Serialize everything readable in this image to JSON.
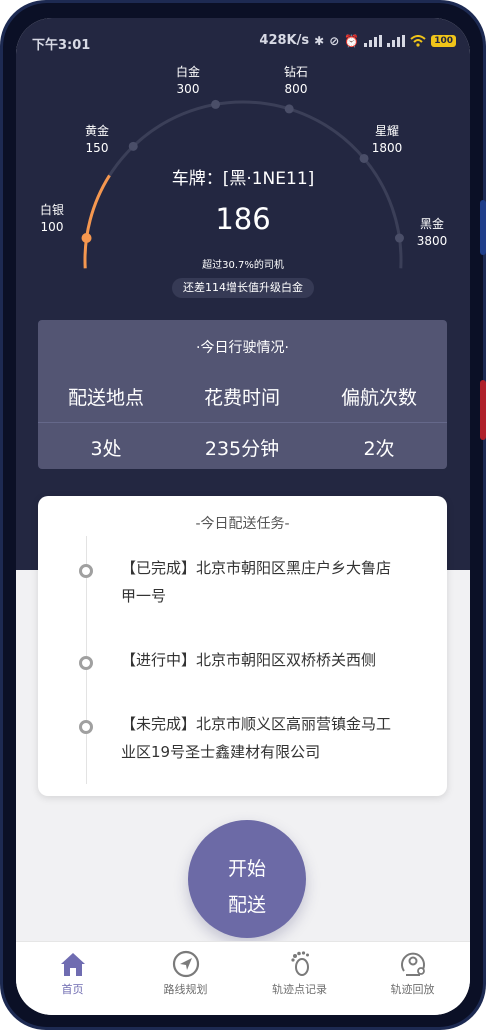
{
  "status_bar": {
    "time": "下午3:01",
    "net_speed": "428K/s",
    "battery": "100"
  },
  "gauge": {
    "levels": [
      {
        "name": "白银",
        "threshold": "100"
      },
      {
        "name": "黄金",
        "threshold": "150"
      },
      {
        "name": "白金",
        "threshold": "300"
      },
      {
        "name": "钻石",
        "threshold": "800"
      },
      {
        "name": "星耀",
        "threshold": "1800"
      },
      {
        "name": "黑金",
        "threshold": "3800"
      }
    ],
    "progress_fraction": 0.19,
    "plate": "车牌：[黑·1NE11]",
    "score": "186",
    "beat_text": "超过30.7%的司机",
    "upgrade_text": "还差114增长值升级白金",
    "colors": {
      "progress": "#f5974f",
      "track": "#3b3f58",
      "bg": "#232741"
    }
  },
  "today_driving": {
    "title": "·今日行驶情况·",
    "headers": [
      "配送地点",
      "花费时间",
      "偏航次数"
    ],
    "values": [
      "3处",
      "235分钟",
      "2次"
    ]
  },
  "tasks": {
    "title": "-今日配送任务-",
    "items": [
      {
        "line1": "【已完成】北京市朝阳区黑庄户乡大鲁店",
        "line2": "甲一号"
      },
      {
        "line1": "【进行中】北京市朝阳区双桥桥关西侧",
        "line2": ""
      },
      {
        "line1": "【未完成】北京市顺义区高丽营镇金马工",
        "line2": "业区19号圣士鑫建材有限公司"
      }
    ]
  },
  "start_button": {
    "line1": "开始",
    "line2": "配送",
    "color": "#6c6aa6"
  },
  "tabbar": {
    "tabs": [
      {
        "label": "首页",
        "icon": "home-icon"
      },
      {
        "label": "路线规划",
        "icon": "navigation-icon"
      },
      {
        "label": "轨迹点记录",
        "icon": "footprint-icon"
      },
      {
        "label": "轨迹回放",
        "icon": "playback-icon"
      }
    ],
    "active_color": "#6f6cb1"
  }
}
